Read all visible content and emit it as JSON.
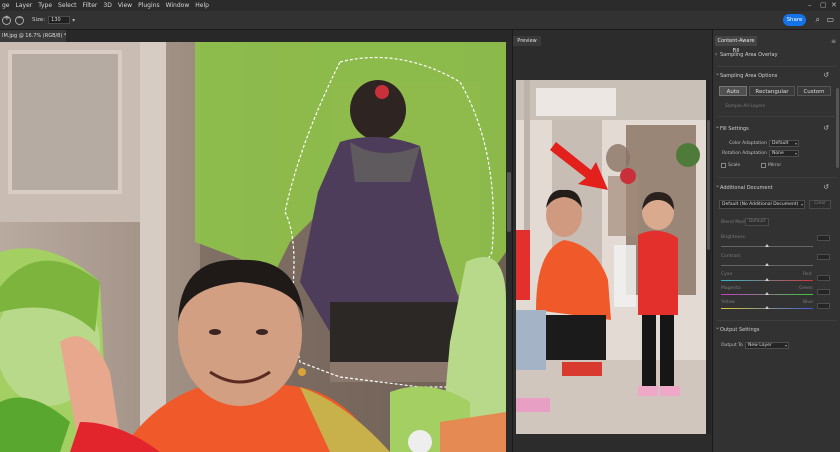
{
  "menubar": {
    "items": [
      "ge",
      "Layer",
      "Type",
      "Select",
      "Filter",
      "3D",
      "View",
      "Plugins",
      "Window",
      "Help"
    ]
  },
  "options": {
    "size_label": "Size:",
    "size_value": "130",
    "share_label": "Share"
  },
  "document": {
    "tab_title": "IM.jpg @ 16.7% (RGB/8) *"
  },
  "preview": {
    "tab_label": "Preview"
  },
  "panel": {
    "tab_label": "Content-Aware Fill",
    "sampling_overlay": "Sampling Area Overlay",
    "sampling_options": "Sampling Area Options",
    "seg_auto": "Auto",
    "seg_rect": "Rectangular",
    "seg_custom": "Custom",
    "sample_all_layers": "Sample All Layers",
    "fill_settings": "Fill Settings",
    "color_adaptation_label": "Color Adaptation",
    "color_adaptation_value": "Default",
    "rotation_adaptation_label": "Rotation Adaptation",
    "rotation_adaptation_value": "None",
    "scale_label": "Scale",
    "mirror_label": "Mirror",
    "additional_document": "Additional Document",
    "doc_select_value": "Default (No Additional Document)",
    "doc_clear": "Clear",
    "blend_mode_label": "Blend Mode",
    "blend_mode_value": "Default",
    "brightness_label": "Brightness",
    "contrast_label": "Contrast",
    "cyan_label": "Cyan",
    "red_label": "Red",
    "magenta_label": "Magenta",
    "green_label": "Green",
    "yellow_label": "Yellow",
    "blue_label": "Blue",
    "output_settings": "Output Settings",
    "output_to_label": "Output To",
    "output_to_value": "New Layer"
  },
  "colors": {
    "accent": "#1473e6",
    "overlay_green": "#8ec14a",
    "arrow_red": "#e3201b"
  },
  "icons": [
    "new-selection-icon",
    "subtract-selection-icon",
    "share-icon",
    "search-icon",
    "frame-icon",
    "menu-icon",
    "reset-icon"
  ]
}
